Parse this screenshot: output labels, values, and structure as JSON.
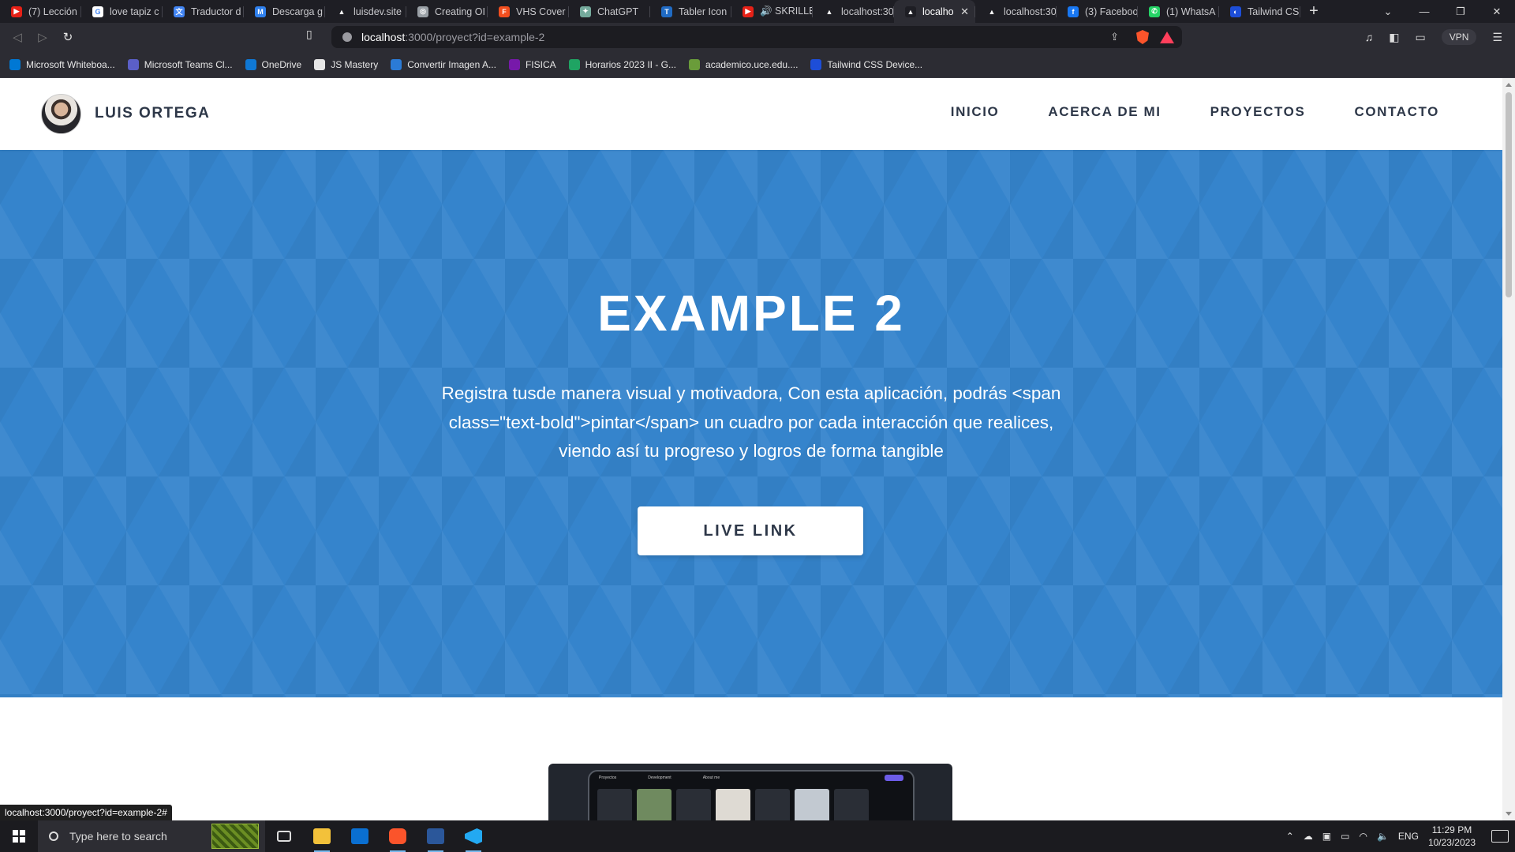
{
  "browser": {
    "tabs": [
      {
        "label": "(7) Lección",
        "color": "#e62117",
        "glyph": "▶"
      },
      {
        "label": "love tapiz c",
        "color": "#ffffff",
        "glyph": "G"
      },
      {
        "label": "Traductor d",
        "color": "#4285f4",
        "glyph": "文"
      },
      {
        "label": "Descarga g",
        "color": "#2f80ed",
        "glyph": "M"
      },
      {
        "label": "luisdev.site",
        "color": "#1e1e24",
        "glyph": "▲"
      },
      {
        "label": "Creating OI",
        "color": "#9aa0a6",
        "glyph": "◎"
      },
      {
        "label": "VHS Cover",
        "color": "#f24e1e",
        "glyph": "F"
      },
      {
        "label": "ChatGPT",
        "color": "#74aa9c",
        "glyph": "✦"
      },
      {
        "label": "Tabler Icon",
        "color": "#206bc4",
        "glyph": "T"
      },
      {
        "label": "🔊 SKRILLE",
        "color": "#e62117",
        "glyph": "▶"
      },
      {
        "label": "localhost:30",
        "color": "#1e1e24",
        "glyph": "▲"
      },
      {
        "label": "localho",
        "color": "#1e1e24",
        "glyph": "▲",
        "active": true
      },
      {
        "label": "localhost:30",
        "color": "#1e1e24",
        "glyph": "▲"
      },
      {
        "label": "(3) Faceboo",
        "color": "#1877f2",
        "glyph": "f"
      },
      {
        "label": "(1) WhatsA",
        "color": "#25d366",
        "glyph": "✆"
      },
      {
        "label": "Tailwind CS",
        "color": "#1d4ed8",
        "glyph": "◐"
      }
    ],
    "new_tab": "+",
    "url_host": "localhost",
    "url_path": ":3000/proyect?id=example-2",
    "vpn_label": "VPN",
    "bookmarks": [
      {
        "label": "Microsoft Whiteboa...",
        "color": "#0078d4"
      },
      {
        "label": "Microsoft Teams Cl...",
        "color": "#5b5fc7"
      },
      {
        "label": "OneDrive",
        "color": "#0f78d4"
      },
      {
        "label": "JS Mastery",
        "color": "#e6e6e6"
      },
      {
        "label": "Convertir Imagen A...",
        "color": "#2b7bd6"
      },
      {
        "label": "FISICA",
        "color": "#7719aa"
      },
      {
        "label": "Horarios 2023 II - G...",
        "color": "#1fa463"
      },
      {
        "label": "academico.uce.edu....",
        "color": "#6a9c3a"
      },
      {
        "label": "Tailwind CSS Device...",
        "color": "#1d4ed8"
      }
    ]
  },
  "site": {
    "brand": "LUIS ORTEGA",
    "menu": [
      "INICIO",
      "ACERCA DE MI",
      "PROYECTOS",
      "CONTACTO"
    ],
    "hero": {
      "title": "EXAMPLE 2",
      "description": "Registra tusde manera visual y motivadora, Con esta aplicación, podrás <span class=\"text-bold\">pintar</span> un cuadro por cada interacción que realices, viendo así tu progreso y logros de forma tangible",
      "button": "LIVE LINK",
      "bg_color": "#3584cc"
    },
    "preview_nav": [
      "Proyectos",
      "Development",
      "About me"
    ]
  },
  "status_url": "localhost:3000/proyect?id=example-2#",
  "taskbar": {
    "search_placeholder": "Type here to search",
    "language": "ENG",
    "time": "11:29 PM",
    "date": "10/23/2023"
  }
}
